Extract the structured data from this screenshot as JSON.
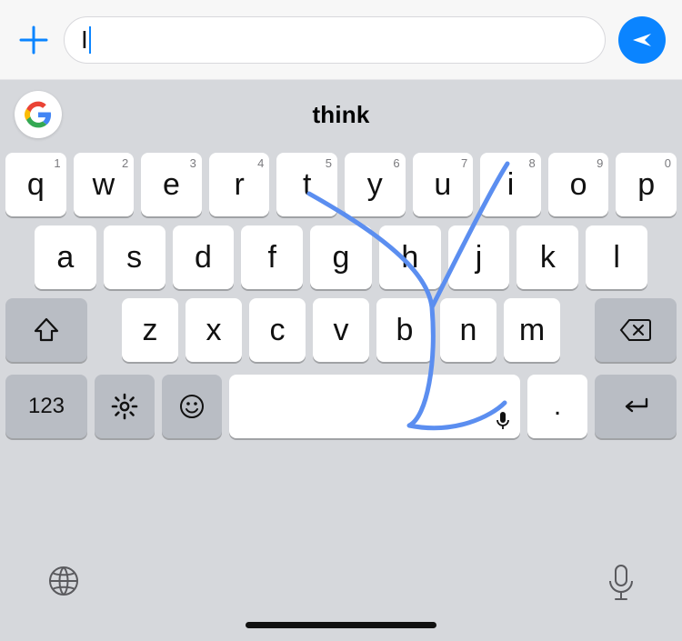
{
  "msgbar": {
    "compose_value": "I"
  },
  "suggestion": {
    "text": "think"
  },
  "keyboard": {
    "row1": [
      {
        "label": "q",
        "sup": "1"
      },
      {
        "label": "w",
        "sup": "2"
      },
      {
        "label": "e",
        "sup": "3"
      },
      {
        "label": "r",
        "sup": "4"
      },
      {
        "label": "t",
        "sup": "5"
      },
      {
        "label": "y",
        "sup": "6"
      },
      {
        "label": "u",
        "sup": "7"
      },
      {
        "label": "i",
        "sup": "8"
      },
      {
        "label": "o",
        "sup": "9"
      },
      {
        "label": "p",
        "sup": "0"
      }
    ],
    "row2": [
      {
        "label": "a"
      },
      {
        "label": "s"
      },
      {
        "label": "d"
      },
      {
        "label": "f"
      },
      {
        "label": "g"
      },
      {
        "label": "h"
      },
      {
        "label": "j"
      },
      {
        "label": "k"
      },
      {
        "label": "l"
      }
    ],
    "row3": [
      {
        "label": "z"
      },
      {
        "label": "x"
      },
      {
        "label": "c"
      },
      {
        "label": "v"
      },
      {
        "label": "b"
      },
      {
        "label": "n"
      },
      {
        "label": "m"
      }
    ],
    "num_label": "123",
    "period_label": "."
  }
}
